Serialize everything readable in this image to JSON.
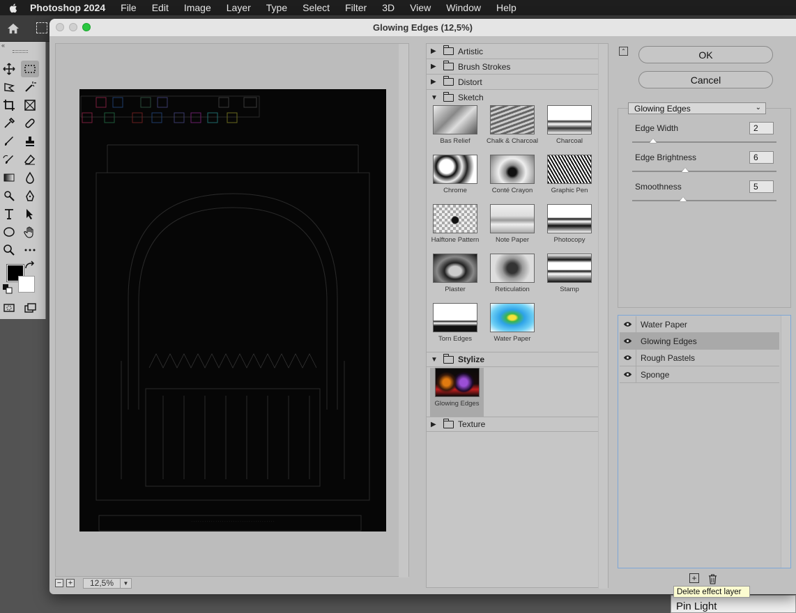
{
  "menubar": {
    "app_name": "Photoshop 2024",
    "items": [
      "File",
      "Edit",
      "Image",
      "Layer",
      "Type",
      "Select",
      "Filter",
      "3D",
      "View",
      "Window",
      "Help"
    ]
  },
  "dialog": {
    "title": "Glowing Edges (12,5%)",
    "zoom_value": "12,5%",
    "ok_label": "OK",
    "cancel_label": "Cancel"
  },
  "filter_browser": {
    "categories_top": [
      "Artistic",
      "Brush Strokes",
      "Distort",
      "Sketch"
    ],
    "sketch_filters": [
      "Bas Relief",
      "Chalk & Charcoal",
      "Charcoal",
      "Chrome",
      "Conté Crayon",
      "Graphic Pen",
      "Halftone Pattern",
      "Note Paper",
      "Photocopy",
      "Plaster",
      "Reticulation",
      "Stamp",
      "Torn Edges",
      "Water Paper"
    ],
    "stylize_label": "Stylize",
    "stylize_filters": [
      "Glowing Edges"
    ],
    "texture_label": "Texture"
  },
  "settings": {
    "selected_filter": "Glowing Edges",
    "params": [
      {
        "label": "Edge Width",
        "value": "2",
        "min": 1,
        "max": 14
      },
      {
        "label": "Edge Brightness",
        "value": "6",
        "min": 0,
        "max": 20
      },
      {
        "label": "Smoothness",
        "value": "5",
        "min": 1,
        "max": 15
      }
    ]
  },
  "effect_layers": {
    "items": [
      "Water Paper",
      "Glowing Edges",
      "Rough Pastels",
      "Sponge"
    ],
    "selected": "Glowing Edges"
  },
  "tooltip": "Delete effect layer",
  "background_menu_item": "Pin Light",
  "icons": {
    "apple": "apple-logo-icon",
    "home": "home-icon",
    "eye": "eye-icon",
    "trash": "trash-icon",
    "new_layer": "new-layer-icon"
  },
  "colors": {
    "accent_blue": "#7da6d6",
    "zoom_green": "#29c740"
  }
}
